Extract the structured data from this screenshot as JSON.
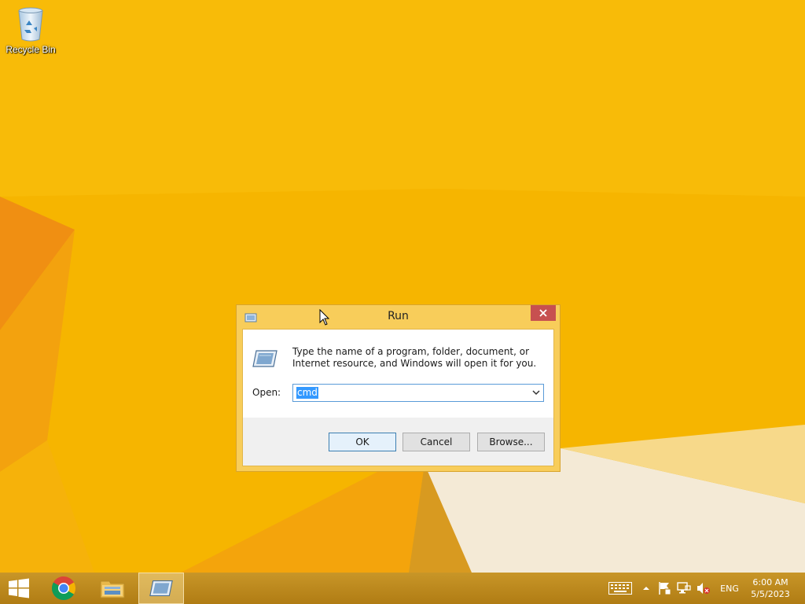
{
  "desktop": {
    "icons": [
      {
        "label": "Recycle Bin",
        "icon": "recycle-bin-icon"
      }
    ]
  },
  "run_dialog": {
    "title": "Run",
    "description": "Type the name of a program, folder, document, or Internet resource, and Windows will open it for you.",
    "open_label": "Open:",
    "open_value": "cmd",
    "buttons": {
      "ok": "OK",
      "cancel": "Cancel",
      "browse": "Browse..."
    }
  },
  "taskbar": {
    "items": [
      {
        "name": "start",
        "icon": "windows-logo-icon"
      },
      {
        "name": "chrome",
        "icon": "chrome-icon"
      },
      {
        "name": "file-explorer",
        "icon": "folder-icon"
      },
      {
        "name": "run",
        "icon": "run-icon",
        "active": true
      }
    ],
    "tray": {
      "language": "ENG",
      "time": "6:00 AM",
      "date": "5/5/2023"
    }
  },
  "colors": {
    "wallpaper": "#f6b500",
    "dialog_frame": "#f8cd5a",
    "close_button": "#c75050",
    "selection": "#3399ff",
    "taskbar": "#b8851a"
  }
}
